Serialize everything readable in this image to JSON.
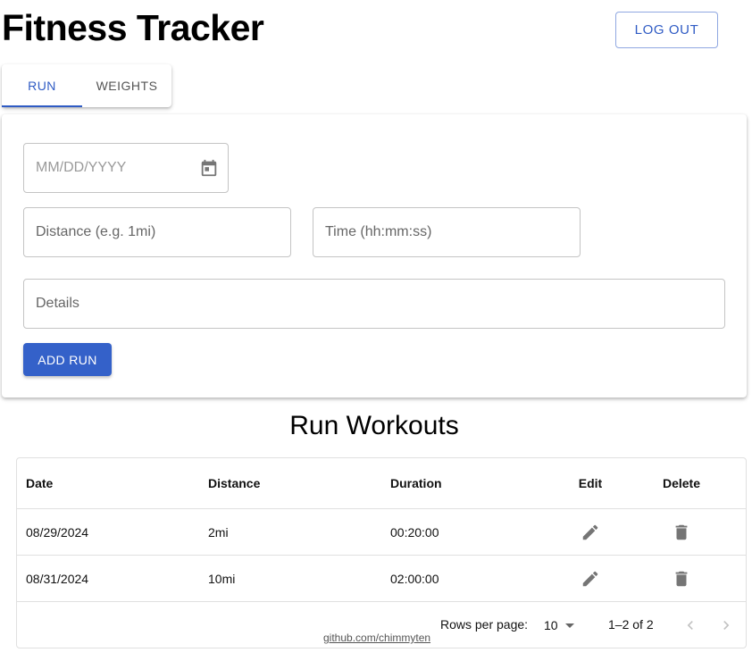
{
  "header": {
    "title": "Fitness Tracker",
    "logout_label": "LOG OUT"
  },
  "tabs": [
    {
      "label": "RUN",
      "selected": true
    },
    {
      "label": "WEIGHTS",
      "selected": false
    }
  ],
  "form": {
    "date_placeholder": "MM/DD/YYYY",
    "distance_placeholder": "Distance (e.g. 1mi)",
    "time_placeholder": "Time (hh:mm:ss)",
    "details_placeholder": "Details",
    "add_button_label": "ADD RUN",
    "date_icon": "calendar-icon"
  },
  "workouts": {
    "title": "Run Workouts",
    "columns": [
      "Date",
      "Distance",
      "Duration",
      "Edit",
      "Delete"
    ],
    "rows": [
      {
        "date": "08/29/2024",
        "distance": "2mi",
        "duration": "00:20:00"
      },
      {
        "date": "08/31/2024",
        "distance": "10mi",
        "duration": "02:00:00"
      }
    ],
    "edit_icon": "pencil-icon",
    "delete_icon": "trash-icon"
  },
  "pagination": {
    "rows_per_page_label": "Rows per page:",
    "rows_per_page_value": "10",
    "range_label": "1–2 of 2"
  },
  "footer": {
    "link_text": "github.com/chimmyten"
  },
  "colors": {
    "accent": "#3461c9",
    "border": "#c4c4c4",
    "icon_gray": "#757575"
  }
}
